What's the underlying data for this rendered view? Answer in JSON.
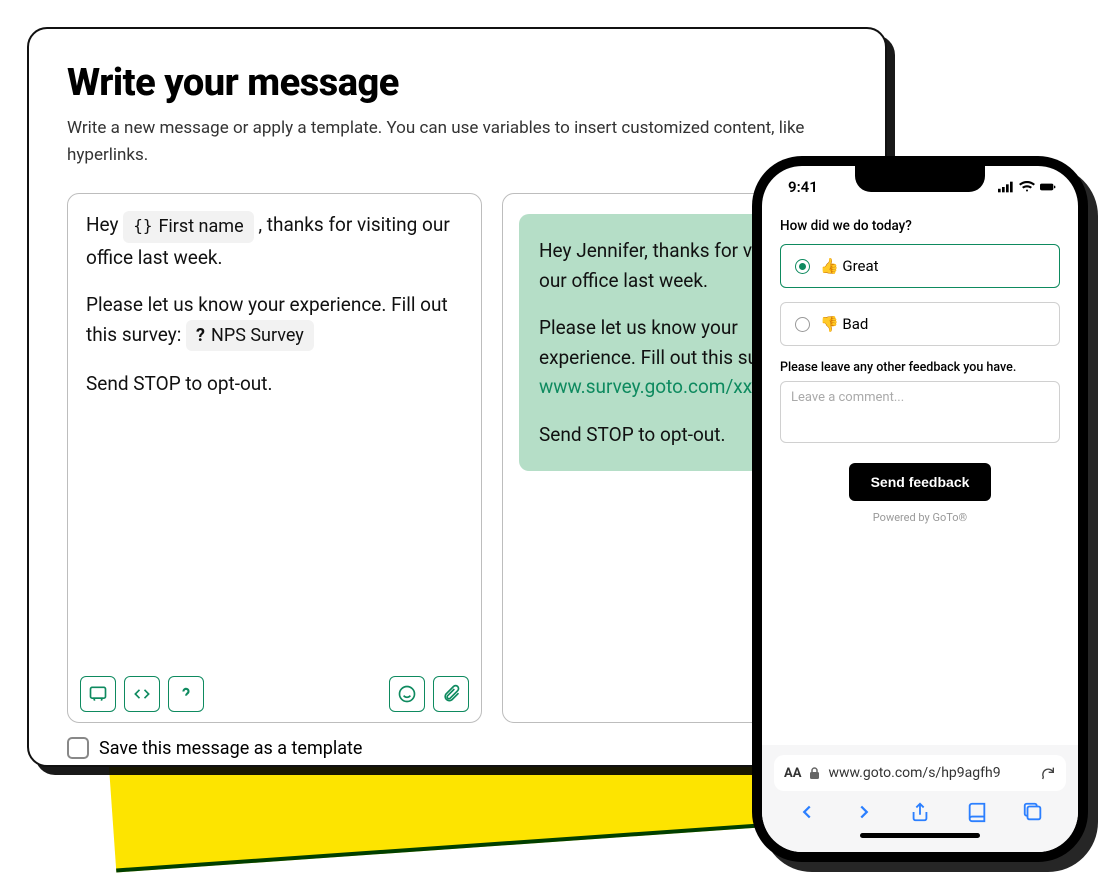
{
  "editor": {
    "title": "Write your message",
    "subtitle": "Write a new message or apply a template. You can use variables to insert customized content, like hyperlinks.",
    "compose": {
      "line1_pre": "Hey ",
      "var1_label": "First name",
      "line1_post": ", thanks for visiting our office last week.",
      "line2_pre": "Please let us know your experience. Fill out this survey: ",
      "var2_label": "NPS Survey",
      "line3": "Send STOP to opt-out."
    },
    "save_label": "Save this message as a template"
  },
  "preview": {
    "p1": "Hey Jennifer, thanks for visiting our office last week.",
    "p2": "Please let us know your experience. Fill out this survey:",
    "link": "www.survey.goto.com/xxxxx",
    "p3": "Send STOP to opt-out."
  },
  "phone": {
    "time": "9:41",
    "question": "How did we do today?",
    "option_great": "👍 Great",
    "option_bad": "👎 Bad",
    "comment_label": "Please leave any other feedback you have.",
    "comment_placeholder": "Leave a comment...",
    "send_label": "Send feedback",
    "powered": "Powered by GoTo®",
    "url": "www.goto.com/s/hp9agfh9"
  }
}
